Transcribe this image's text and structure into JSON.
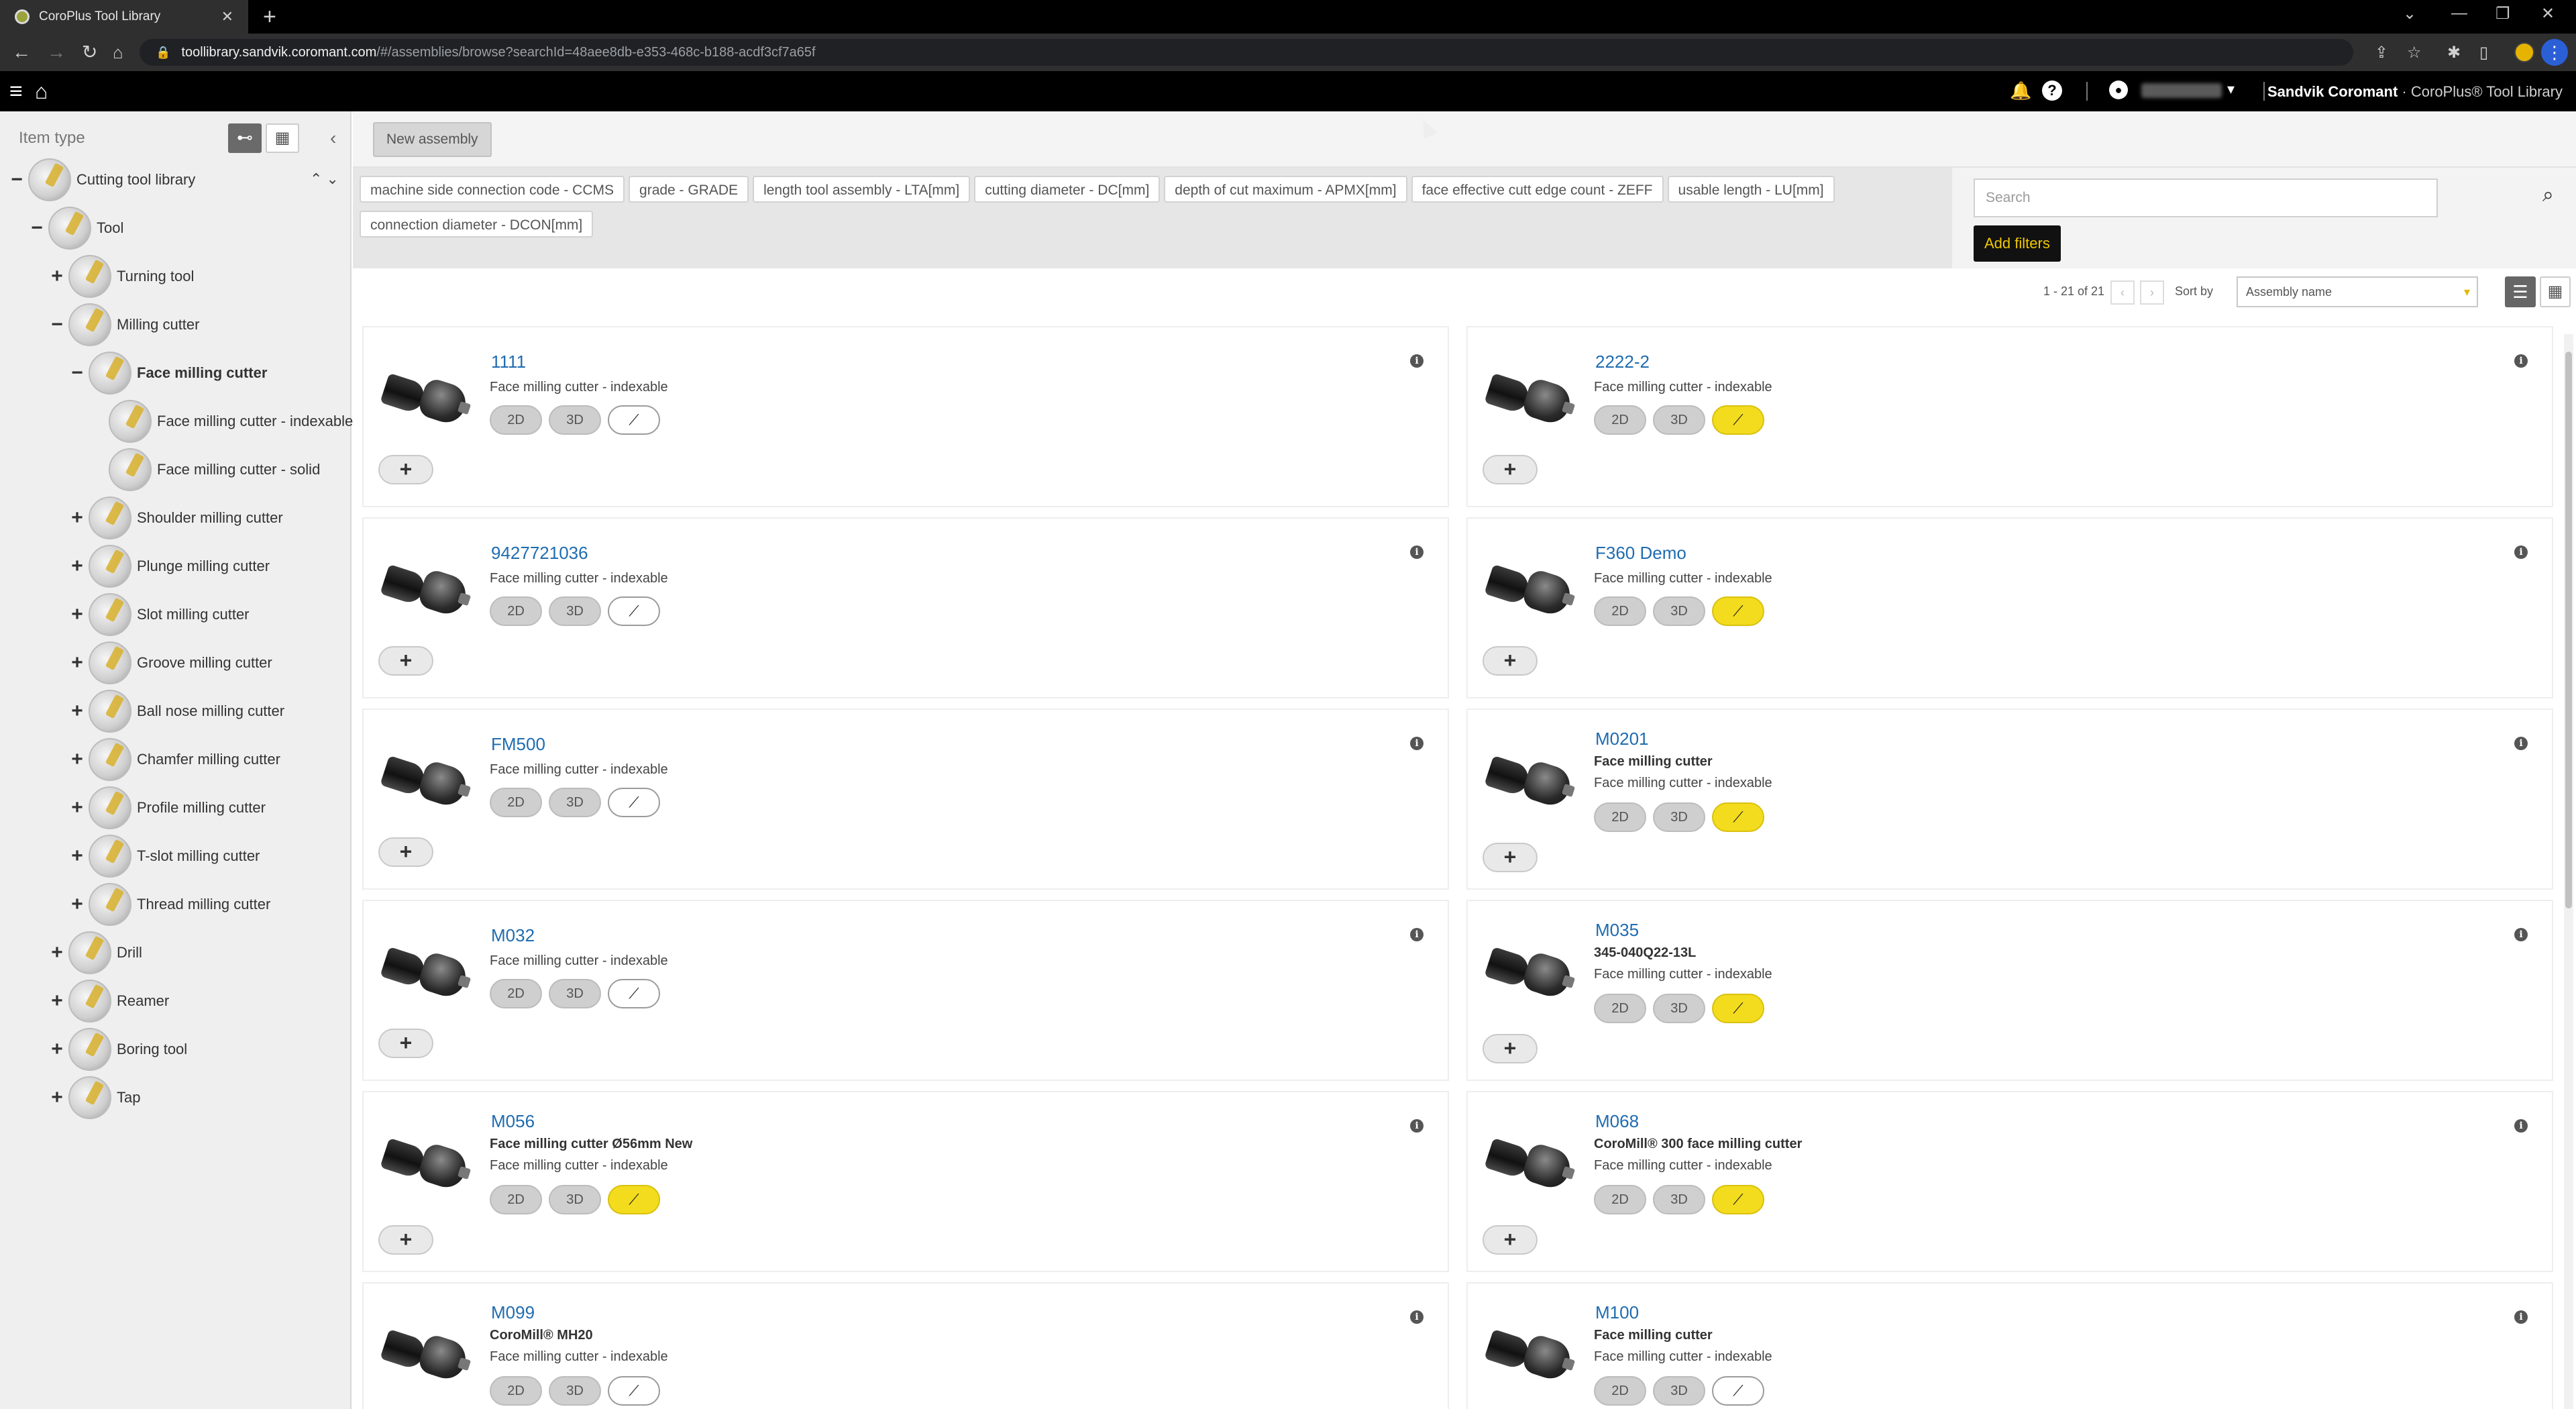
{
  "browser": {
    "tab_title": "CoroPlus Tool Library",
    "tab_close": "✕",
    "new_tab": "+",
    "url_host": "toollibrary.sandvik.coromant.com",
    "url_rest": "/#/assemblies/browse?searchId=48aee8db-e353-468c-b188-acdf3cf7a65f"
  },
  "app": {
    "brand_bold": "Sandvik Coromant",
    "brand_rest": " · CoroPlus® Tool Library"
  },
  "sidebar": {
    "title": "Item type",
    "tree": [
      {
        "label": "Cutting tool library",
        "toggle": "−",
        "depth": 0
      },
      {
        "label": "Tool",
        "toggle": "−",
        "depth": 1
      },
      {
        "label": "Turning tool",
        "toggle": "+",
        "depth": 2
      },
      {
        "label": "Milling cutter",
        "toggle": "−",
        "depth": 2
      },
      {
        "label": "Face milling cutter",
        "toggle": "−",
        "depth": 3,
        "selected": true
      },
      {
        "label": "Face milling cutter - indexable",
        "toggle": "",
        "depth": 4
      },
      {
        "label": "Face milling cutter - solid",
        "toggle": "",
        "depth": 4
      },
      {
        "label": "Shoulder milling cutter",
        "toggle": "+",
        "depth": 3
      },
      {
        "label": "Plunge milling cutter",
        "toggle": "+",
        "depth": 3
      },
      {
        "label": "Slot milling cutter",
        "toggle": "+",
        "depth": 3
      },
      {
        "label": "Groove milling cutter",
        "toggle": "+",
        "depth": 3
      },
      {
        "label": "Ball nose milling cutter",
        "toggle": "+",
        "depth": 3
      },
      {
        "label": "Chamfer milling cutter",
        "toggle": "+",
        "depth": 3
      },
      {
        "label": "Profile milling cutter",
        "toggle": "+",
        "depth": 3
      },
      {
        "label": "T-slot milling cutter",
        "toggle": "+",
        "depth": 3
      },
      {
        "label": "Thread milling cutter",
        "toggle": "+",
        "depth": 3
      },
      {
        "label": "Drill",
        "toggle": "+",
        "depth": 2
      },
      {
        "label": "Reamer",
        "toggle": "+",
        "depth": 2
      },
      {
        "label": "Boring tool",
        "toggle": "+",
        "depth": 2
      },
      {
        "label": "Tap",
        "toggle": "+",
        "depth": 2
      }
    ]
  },
  "toolbar": {
    "new_assembly": "New assembly"
  },
  "filters": {
    "chips": [
      "machine side connection code - CCMS",
      "grade - GRADE",
      "length tool assembly - LTA[mm]",
      "cutting diameter - DC[mm]",
      "depth of cut maximum - APMX[mm]",
      "face effective cutt edge count - ZEFF",
      "usable length - LU[mm]",
      "connection diameter - DCON[mm]"
    ],
    "search_placeholder": "Search",
    "add_filters": "Add filters"
  },
  "pager": {
    "count": "1 - 21 of 21",
    "prev": "‹",
    "next": "›",
    "sort_label": "Sort by",
    "sort_value": "Assembly name"
  },
  "badge_labels": {
    "two_d": "2D",
    "three_d": "3D"
  },
  "results": [
    {
      "name": "1111",
      "lines": [
        "Face milling cutter - indexable"
      ],
      "bold_first": false,
      "tool_active": false
    },
    {
      "name": "2222-2",
      "lines": [
        "Face milling cutter - indexable"
      ],
      "bold_first": false,
      "tool_active": true
    },
    {
      "name": "9427721036",
      "lines": [
        "Face milling cutter - indexable"
      ],
      "bold_first": false,
      "tool_active": false
    },
    {
      "name": "F360 Demo",
      "lines": [
        "Face milling cutter - indexable"
      ],
      "bold_first": false,
      "tool_active": true
    },
    {
      "name": "FM500",
      "lines": [
        "Face milling cutter - indexable"
      ],
      "bold_first": false,
      "tool_active": false
    },
    {
      "name": "M0201",
      "lines": [
        "Face milling cutter",
        "Face milling cutter - indexable"
      ],
      "bold_first": true,
      "tool_active": true
    },
    {
      "name": "M032",
      "lines": [
        "Face milling cutter - indexable"
      ],
      "bold_first": false,
      "tool_active": false
    },
    {
      "name": "M035",
      "lines": [
        "345-040Q22-13L",
        "Face milling cutter - indexable"
      ],
      "bold_first": true,
      "tool_active": true
    },
    {
      "name": "M056",
      "lines": [
        "Face milling cutter Ø56mm New",
        "Face milling cutter - indexable"
      ],
      "bold_first": true,
      "tool_active": true
    },
    {
      "name": "M068",
      "lines": [
        "CoroMill® 300 face milling cutter",
        "Face milling cutter - indexable"
      ],
      "bold_first": true,
      "tool_active": true
    },
    {
      "name": "M099",
      "lines": [
        "CoroMill® MH20",
        "Face milling cutter - indexable"
      ],
      "bold_first": true,
      "tool_active": false
    },
    {
      "name": "M100",
      "lines": [
        "Face milling cutter",
        "Face milling cutter - indexable"
      ],
      "bold_first": true,
      "tool_active": false
    }
  ]
}
